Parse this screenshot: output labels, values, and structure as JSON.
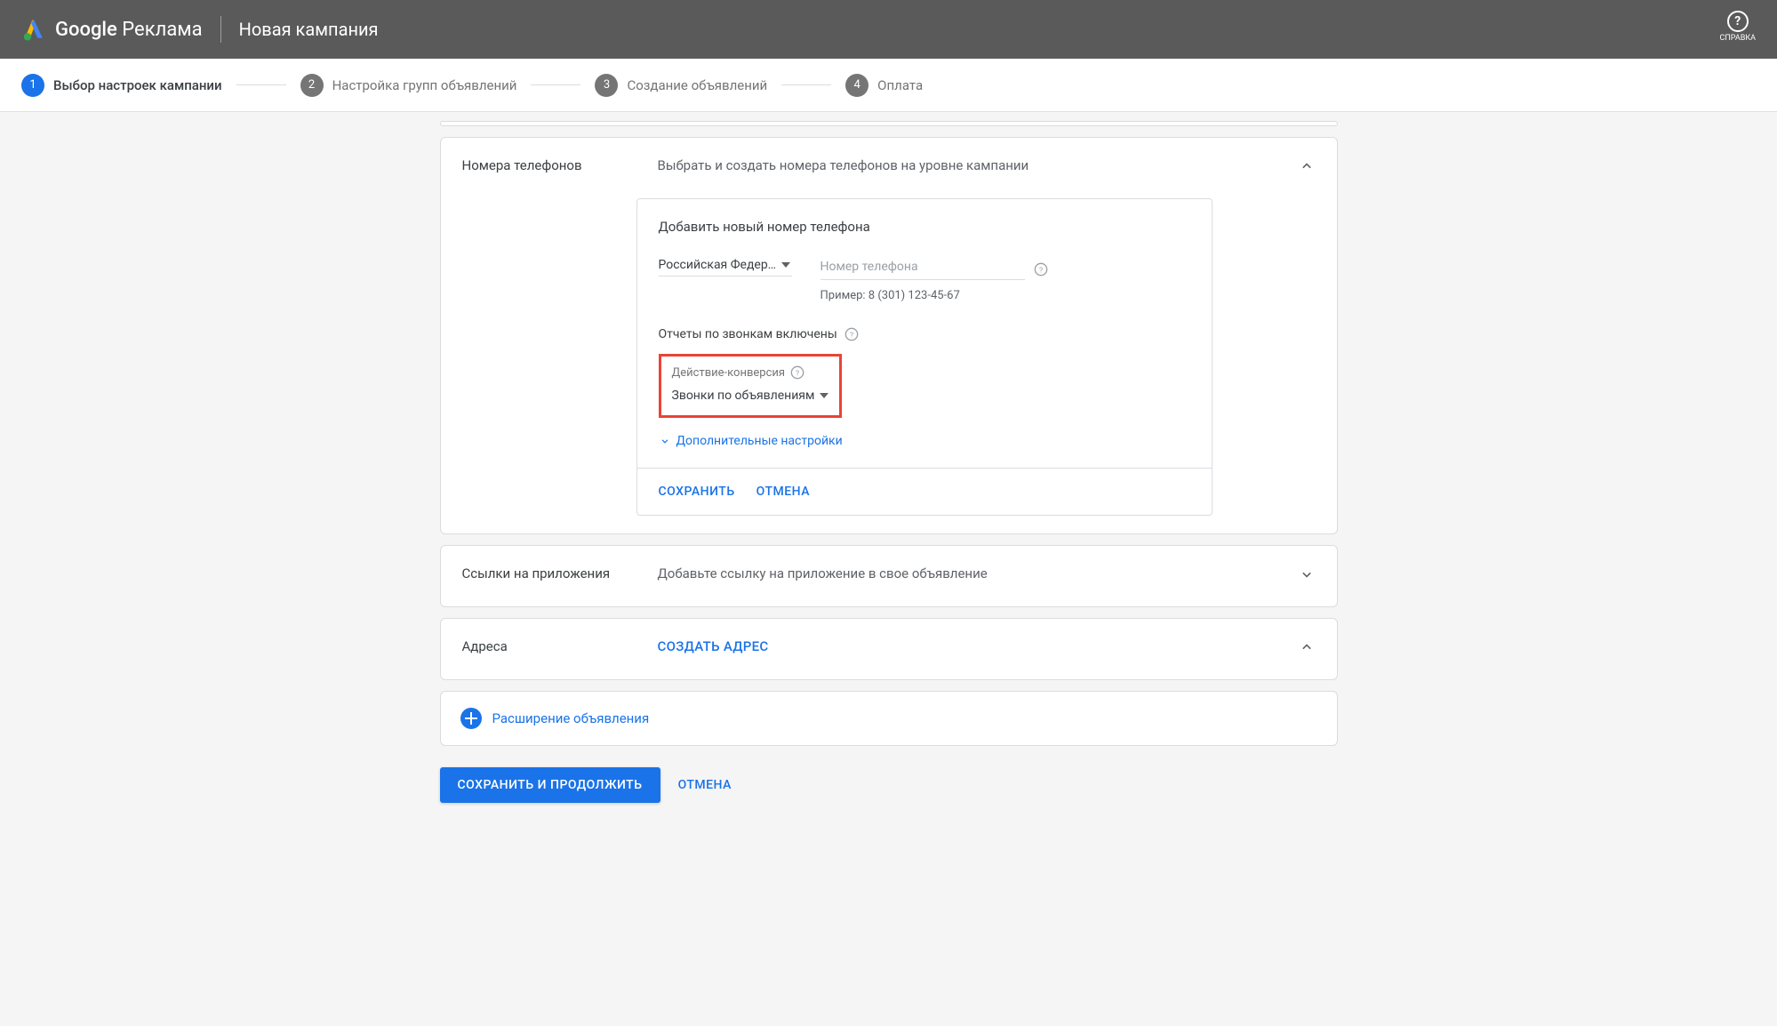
{
  "header": {
    "product": "Google",
    "product2": "Реклама",
    "subtitle": "Новая кампания",
    "help_label": "СПРАВКА"
  },
  "steps": [
    {
      "num": "1",
      "label": "Выбор настроек кампании",
      "active": true
    },
    {
      "num": "2",
      "label": "Настройка групп объявлений",
      "active": false
    },
    {
      "num": "3",
      "label": "Создание объявлений",
      "active": false
    },
    {
      "num": "4",
      "label": "Оплата",
      "active": false
    }
  ],
  "phone_panel": {
    "title": "Номера телефонов",
    "desc": "Выбрать и создать номера телефонов на уровне кампании",
    "card_title": "Добавить новый номер телефона",
    "country": "Российская Федер…",
    "phone_placeholder": "Номер телефона",
    "phone_hint": "Пример: 8 (301) 123-45-67",
    "reports_label": "Отчеты по звонкам включены",
    "conv_label": "Действие-конверсия",
    "conv_value": "Звонки по объявлениям",
    "advanced": "Дополнительные настройки",
    "save": "СОХРАНИТЬ",
    "cancel": "ОТМЕНА"
  },
  "app_panel": {
    "title": "Ссылки на приложения",
    "desc": "Добавьте ссылку на приложение в свое объявление"
  },
  "addr_panel": {
    "title": "Адреса",
    "action": "СОЗДАТЬ АДРЕС"
  },
  "ext_panel": {
    "label": "Расширение объявления"
  },
  "footer": {
    "save": "СОХРАНИТЬ И ПРОДОЛЖИТЬ",
    "cancel": "ОТМЕНА"
  }
}
